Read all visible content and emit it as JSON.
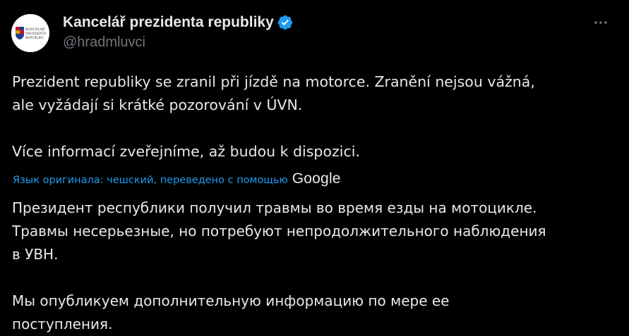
{
  "author": {
    "display_name": "Kancelář prezidenta republiky",
    "handle": "@hradmluvci",
    "avatar_text": [
      "KANCELÁŘ",
      "PREZIDENTA",
      "REPUBLIKY"
    ],
    "verified": true
  },
  "tweet": {
    "original_paragraphs": [
      [
        "Prezident republiky se zranil při jízdě na motorce. Zranění nejsou vážná,",
        "ale vyžádají si krátké pozorování v ÚVN."
      ],
      [
        "Více informací zveřejníme, až budou k dispozici."
      ]
    ],
    "translation_label": "Язык оригинала: чешский, переведено с помощью",
    "translation_provider": "Google",
    "translated_paragraphs": [
      [
        "Президент республики получил травмы во время езды на мотоцикле.",
        "Травмы несерьезные, но потребуют непродолжительного наблюдения",
        "в УВН."
      ],
      [
        "Мы опубликуем дополнительную информацию по мере ее",
        "поступления."
      ]
    ]
  },
  "colors": {
    "background": "#000000",
    "text": "#e7e9ea",
    "secondary": "#71767b",
    "accent": "#1d9bf0"
  },
  "icons": {
    "verified": "verified-badge-icon",
    "more": "more-options-icon"
  }
}
